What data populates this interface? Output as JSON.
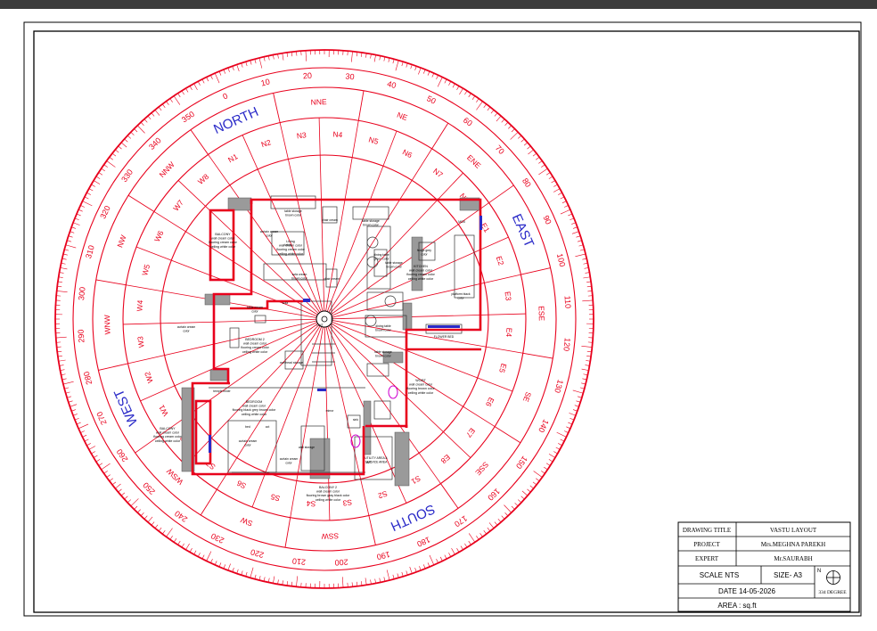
{
  "colors": {
    "plan_red": "#e8001c",
    "direction_blue": "#2a2ac8",
    "wall_gray": "#9a9a9a",
    "sheet_border": "#000000",
    "top_bar": "#3c3c3c"
  },
  "directions": {
    "north": "NORTH",
    "east": "EAST",
    "south": "SOUTH",
    "west": "WEST"
  },
  "degree_labels": [
    "0",
    "10",
    "20",
    "30",
    "40",
    "50",
    "60",
    "70",
    "80",
    "90",
    "100",
    "110",
    "120",
    "130",
    "140",
    "150",
    "160",
    "170",
    "180",
    "190",
    "200",
    "210",
    "220",
    "230",
    "240",
    "250",
    "260",
    "270",
    "280",
    "290",
    "300",
    "310",
    "320",
    "330",
    "340",
    "350"
  ],
  "zone_labels": [
    "NNE",
    "NE",
    "ENE",
    "EAST",
    "ESE",
    "SE",
    "SSE",
    "SOUTH",
    "SSW",
    "SW",
    "WSW",
    "WEST",
    "WNW",
    "NW",
    "NNW",
    "NORTH"
  ],
  "pada_labels": [
    "N6",
    "N7",
    "N8",
    "E1",
    "E2",
    "E3",
    "E4",
    "E5",
    "E6",
    "E7",
    "E8",
    "S1",
    "S2",
    "S3",
    "S4",
    "S5",
    "S6",
    "S7",
    "S8",
    "W1",
    "W2",
    "W3",
    "W4",
    "W5",
    "W6",
    "W7",
    "W8",
    "N1",
    "N2",
    "N3",
    "N4",
    "N5"
  ],
  "rooms": [
    {
      "name": "Living",
      "lines": [
        "wall cream color",
        "flooring cream color",
        "ceiling white color"
      ]
    },
    {
      "name": "KITCHEN",
      "lines": [
        "wall cream color",
        "flooring cream color",
        "ceiling white color"
      ]
    },
    {
      "name": "BEDROOM 2",
      "lines": [
        "wall cream color",
        "flooring cream color",
        "ceiling white color"
      ]
    },
    {
      "name": "BEDROOM",
      "lines": [
        "wall cream color",
        "flooring black grey brown color",
        "ceiling white color"
      ]
    },
    {
      "name": "BALCONY",
      "lines": [
        "wall cream color",
        "flooring cream color",
        "ceiling white color"
      ]
    },
    {
      "name": "WC/BT",
      "lines": [
        "wall cream color",
        "flooring brown color",
        "ceiling white color"
      ]
    },
    {
      "name": "BALCONY 2",
      "lines": [
        "wall cream color",
        "flooring brown gray black color",
        "ceiling white color"
      ]
    },
    {
      "name": "BALCONY",
      "lines": [
        "wall cream color",
        "flooring cream color",
        "ceiling white color"
      ]
    }
  ],
  "furniture": [
    "table storage brown color",
    "chair cream",
    "table storage brown color",
    "curtain cream color",
    "table",
    "sofa cream brown color",
    "chair cream",
    "dining table green color",
    "fridge grey color",
    "table storage brown color",
    "platform black color",
    "MCB",
    "table cream color",
    "sofa",
    "curtain cream color",
    "dining table brown color",
    "FLOWER BED",
    "table storage brown color",
    "overhead storage",
    "temple mixer",
    "mirror",
    "curtain cream color",
    "curtain cream color",
    "wall storage",
    "UTILITY AREA & SERVICE AREA",
    "A/C",
    "sink",
    "bed",
    "cot",
    "OHT"
  ],
  "title_block": {
    "drawing_title_label": "DRAWING TITLE",
    "drawing_title_value": "VASTU LAYOUT",
    "project_label": "PROJECT",
    "project_value": "Mrs.MEGHNA PAREKH",
    "expert_label": "EXPERT",
    "expert_value": "Mr.SAURABH",
    "scale": "SCALE NTS",
    "size": "SIZE- A3",
    "date": "DATE 14-05-2026",
    "area": "AREA : sq.ft",
    "north_mark": "N",
    "degree_note": "334 DEGREE"
  }
}
